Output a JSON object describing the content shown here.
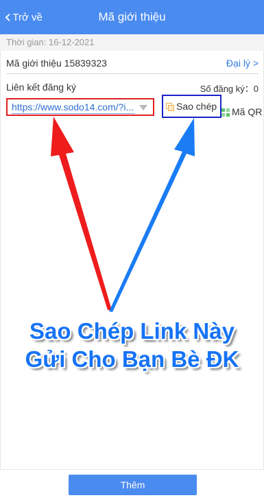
{
  "header": {
    "back_label": "Trở về",
    "title": "Mã giới thiệu"
  },
  "info": {
    "date_label": "Thời gian:  16-12-2021",
    "referral_code": "Mã giới thiệu 15839323",
    "agent_link": "Đại lý >"
  },
  "registration": {
    "link_label": "Liên kết đăng ký",
    "count_label": "Số đăng ký：0",
    "url": "https://www.sodo14.com/?i...",
    "copy_label": "Sao chép",
    "qr_label": "Mã QR"
  },
  "annotation": {
    "line1": "Sao Chép Link Này",
    "line2": "Gửi Cho Bạn Bè ĐK",
    "arrow_colors": {
      "left": "#ee1c1c",
      "right": "#1a7cf5"
    },
    "box_colors": {
      "link": "#e02020",
      "copy": "#1a22c8"
    }
  },
  "footer": {
    "add_button": "Thêm"
  },
  "colors": {
    "accent": "#4a8bf0",
    "link": "#2f7be5"
  }
}
